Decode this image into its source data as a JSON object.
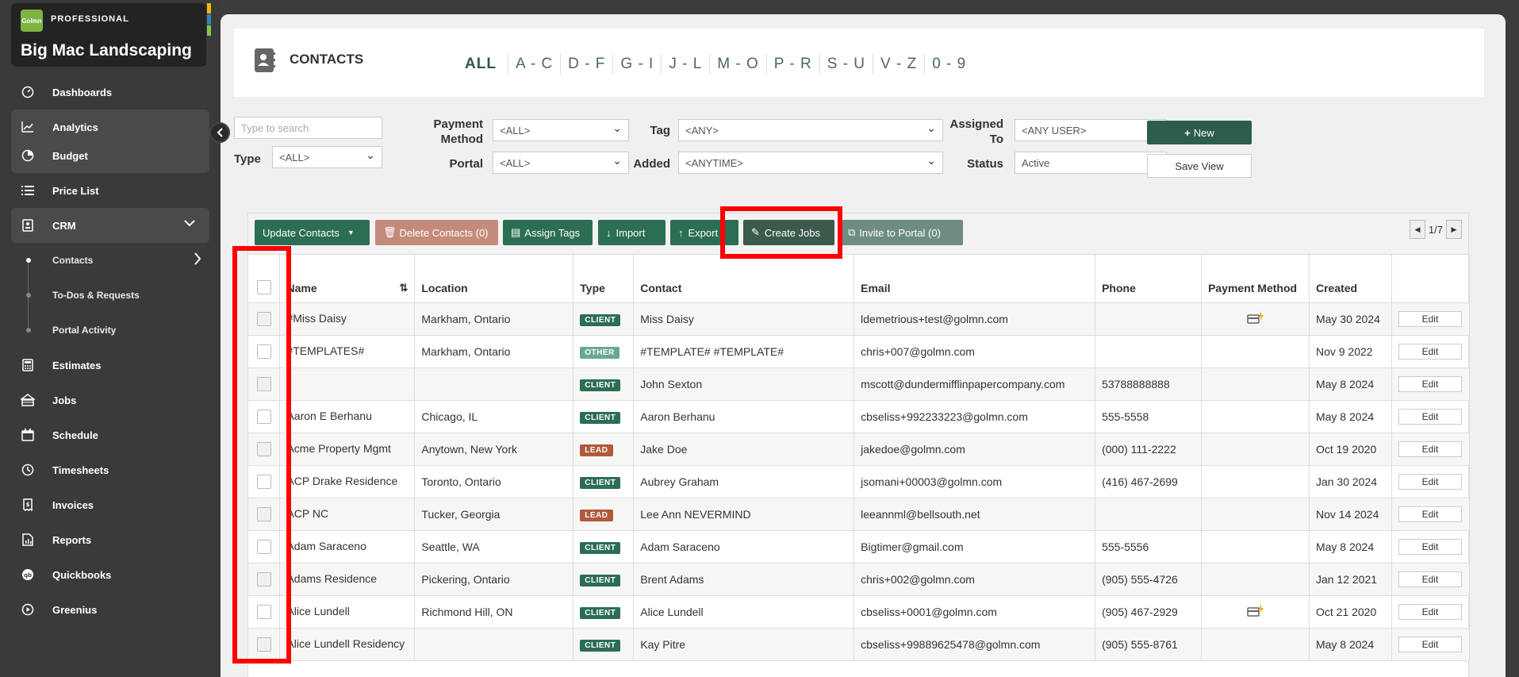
{
  "brand": {
    "logo": "Golmn",
    "plan": "PROFESSIONAL",
    "company": "Big Mac Landscaping",
    "bar_colors": [
      "#f2b705",
      "#2e86c1",
      "#8bc34a"
    ]
  },
  "nav": [
    {
      "label": "Dashboards",
      "icon": "dashboard-icon"
    },
    {
      "label": "Analytics",
      "icon": "analytics-icon"
    },
    {
      "label": "Budget",
      "icon": "budget-icon"
    },
    {
      "label": "Price List",
      "icon": "list-icon"
    },
    {
      "label": "CRM",
      "icon": "crm-icon"
    },
    {
      "label": "Contacts"
    },
    {
      "label": "To-Dos & Requests"
    },
    {
      "label": "Portal Activity"
    },
    {
      "label": "Estimates",
      "icon": "estimates-icon"
    },
    {
      "label": "Jobs",
      "icon": "jobs-icon"
    },
    {
      "label": "Schedule",
      "icon": "calendar-icon"
    },
    {
      "label": "Timesheets",
      "icon": "clock-icon"
    },
    {
      "label": "Invoices",
      "icon": "invoice-icon"
    },
    {
      "label": "Reports",
      "icon": "report-icon"
    },
    {
      "label": "Quickbooks",
      "icon": "quickbooks-icon"
    },
    {
      "label": "Greenius",
      "icon": "play-icon"
    }
  ],
  "header": {
    "title": "CONTACTS",
    "alpha": [
      "ALL",
      "A - C",
      "D - F",
      "G - I",
      "J - L",
      "M - O",
      "P - R",
      "S - U",
      "V - Z",
      "0 - 9"
    ]
  },
  "filters": {
    "search_placeholder": "Type to search",
    "type_label": "Type",
    "type_value": "<ALL>",
    "payment_label": "Payment Method",
    "payment_value": "<ALL>",
    "portal_label": "Portal",
    "portal_value": "<ALL>",
    "tag_label": "Tag",
    "tag_value": "<ANY>",
    "added_label": "Added",
    "added_value": "<ANYTIME>",
    "assigned_label": "Assigned To",
    "assigned_value": "<ANY USER>",
    "status_label": "Status",
    "status_value": "Active",
    "new_label": "New",
    "save_view_label": "Save View"
  },
  "toolbar": {
    "update": "Update Contacts",
    "delete": "Delete Contacts (0)",
    "assign_tags": "Assign Tags",
    "import": "Import",
    "export": "Export",
    "create_jobs": "Create Jobs",
    "invite": "Invite to Portal (0)",
    "page": "1/7"
  },
  "columns": [
    "Name",
    "Location",
    "Type",
    "Contact",
    "Email",
    "Phone",
    "Payment Method",
    "Created",
    ""
  ],
  "rows": [
    {
      "name": "#Miss Daisy",
      "location": "Markham, Ontario",
      "type": "CLIENT",
      "contact": "Miss Daisy",
      "email": "ldemetrious+test@golmn.com",
      "phone": "",
      "payment": true,
      "created": "May 30 2024"
    },
    {
      "name": "#TEMPLATES#",
      "location": "Markham, Ontario",
      "type": "OTHER",
      "contact": "#TEMPLATE# #TEMPLATE#",
      "email": "chris+007@golmn.com",
      "phone": "",
      "payment": false,
      "created": "Nov 9 2022"
    },
    {
      "name": "",
      "location": "",
      "type": "CLIENT",
      "contact": "John Sexton",
      "email": "mscott@dundermifflinpapercompany.com",
      "phone": "53788888888",
      "payment": false,
      "created": "May 8 2024"
    },
    {
      "name": "Aaron E Berhanu",
      "location": "Chicago, IL",
      "type": "CLIENT",
      "contact": "Aaron Berhanu",
      "email": "cbseliss+992233223@golmn.com",
      "phone": "555-5558",
      "payment": false,
      "created": "May 8 2024"
    },
    {
      "name": "Acme Property Mgmt",
      "location": "Anytown, New York",
      "type": "LEAD",
      "contact": "Jake Doe",
      "email": "jakedoe@golmn.com",
      "phone": "(000) 111-2222",
      "payment": false,
      "created": "Oct 19 2020"
    },
    {
      "name": "ACP Drake Residence",
      "location": "Toronto, Ontario",
      "type": "CLIENT",
      "contact": "Aubrey Graham",
      "email": "jsomani+00003@golmn.com",
      "phone": "(416) 467-2699",
      "payment": false,
      "created": "Jan 30 2024"
    },
    {
      "name": "ACP NC",
      "location": "Tucker, Georgia",
      "type": "LEAD",
      "contact": "Lee Ann NEVERMIND",
      "email": "leeannml@bellsouth.net",
      "phone": "",
      "payment": false,
      "created": "Nov 14 2024"
    },
    {
      "name": "Adam Saraceno",
      "location": "Seattle, WA",
      "type": "CLIENT",
      "contact": "Adam Saraceno",
      "email": "Bigtimer@gmail.com",
      "phone": "555-5556",
      "payment": false,
      "created": "May 8 2024"
    },
    {
      "name": "Adams Residence",
      "location": "Pickering, Ontario",
      "type": "CLIENT",
      "contact": "Brent Adams",
      "email": "chris+002@golmn.com",
      "phone": "(905) 555-4726",
      "payment": false,
      "created": "Jan 12 2021"
    },
    {
      "name": "Alice Lundell",
      "location": "Richmond Hill, ON",
      "type": "CLIENT",
      "contact": "Alice Lundell",
      "email": "cbseliss+0001@golmn.com",
      "phone": "(905) 467-2929",
      "payment": true,
      "created": "Oct 21 2020"
    },
    {
      "name": "Alice Lundell Residency",
      "location": "",
      "type": "CLIENT",
      "contact": "Kay Pitre",
      "email": "cbseliss+99889625478@golmn.com",
      "phone": "(905) 555-8761",
      "payment": false,
      "created": "May 8 2024"
    }
  ],
  "edit_label": "Edit",
  "colors": {
    "client": "#2c6e53",
    "other": "#6aa88e",
    "lead": "#b05a3c",
    "accent": "#2c5e4b",
    "highlight": "#ff0000"
  }
}
